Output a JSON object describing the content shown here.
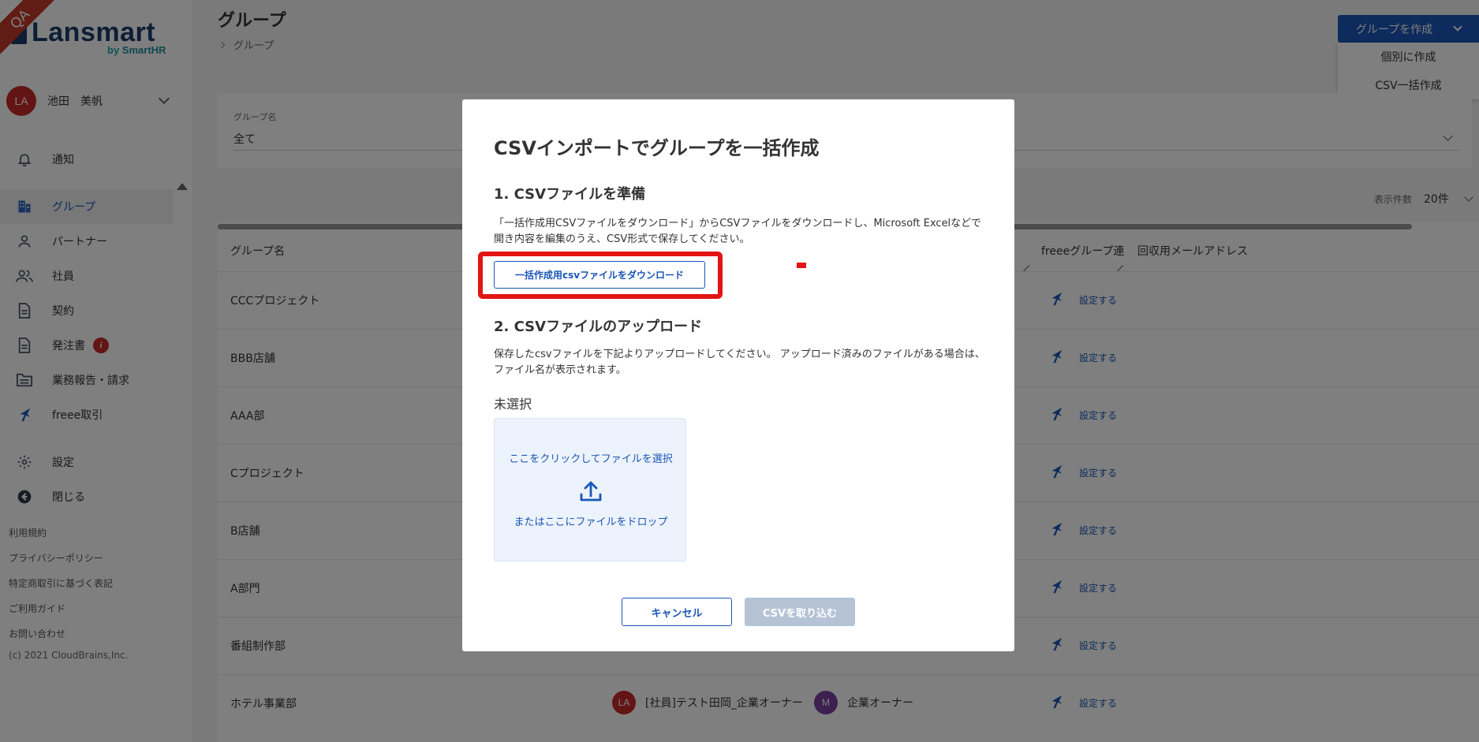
{
  "ribbon": "QA",
  "brand": {
    "name": "Lansmart",
    "sub_by": "by",
    "sub_name": "SmartHR"
  },
  "user": {
    "initials": "LA",
    "name": "池田　美帆"
  },
  "nav": {
    "notifications": "通知",
    "groups": "グループ",
    "partners": "パートナー",
    "employees": "社員",
    "contracts": "契約",
    "orders": "発注書",
    "orders_badge": "i",
    "reports": "業務報告・請求",
    "freee": "freee取引",
    "settings": "設定",
    "close": "閉じる"
  },
  "footer": {
    "terms": "利用規約",
    "privacy": "プライバシーポリシー",
    "commercial": "特定商取引に基づく表記",
    "guide": "ご利用ガイド",
    "contact": "お問い合わせ",
    "copyright": "(c) 2021 CloudBrains,Inc."
  },
  "page": {
    "title": "グループ",
    "breadcrumb": "グループ"
  },
  "create": {
    "label": "グループを作成",
    "menu": [
      "個別に作成",
      "CSV一括作成"
    ]
  },
  "filter": {
    "label": "グループ名",
    "value": "全て"
  },
  "per_page": {
    "label": "表示件数",
    "value": "20件"
  },
  "table": {
    "headers": {
      "group": "グループ名",
      "freee": "freeeグループ連",
      "email": "回収用メールアドレス"
    },
    "setting_label": "設定する",
    "rows": [
      "CCCプロジェクト",
      "BBB店舗",
      "AAA部",
      "Cプロジェクト",
      "B店舗",
      "A部門",
      "番組制作部",
      "ホテル事業部"
    ],
    "last_row_members": [
      {
        "initials": "LA",
        "name": "[社員]テスト田岡_企業オーナー",
        "color": "#c62828"
      },
      {
        "initials": "M",
        "name": "企業オーナー",
        "color": "#7b3fa0"
      }
    ]
  },
  "modal": {
    "title": "CSVインポートでグループを一括作成",
    "step1_title": "1. CSVファイルを準備",
    "step1_desc": "「一括作成用CSVファイルをダウンロード」からCSVファイルをダウンロードし、Microsoft Excelなどで開き内容を編集のうえ、CSV形式で保存してください。",
    "download_button": "一括作成用csvファイルをダウンロード",
    "step2_title": "2. CSVファイルのアップロード",
    "step2_desc": "保存したcsvファイルを下記よりアップロードしてください。 アップロード済みのファイルがある場合は、ファイル名が表示されます。",
    "file_status": "未選択",
    "drop_top": "ここをクリックしてファイルを選択",
    "drop_bottom": "またはここにファイルをドロップ",
    "cancel": "キャンセル",
    "import": "CSVを取り込む"
  },
  "colors": {
    "accent": "#1a56b8",
    "highlight": "#e31414",
    "disabled": "#b6c3d6"
  }
}
